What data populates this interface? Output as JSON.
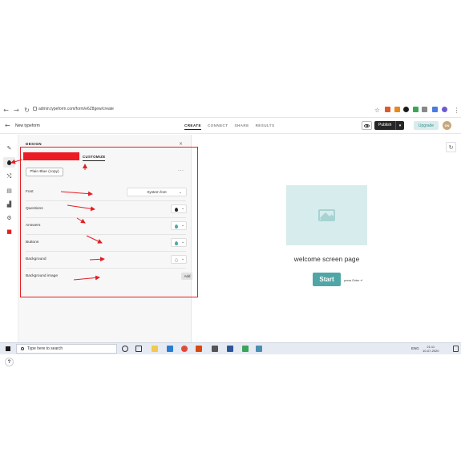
{
  "browser": {
    "url": "admin.typeform.com/form/e6Z8gew/create"
  },
  "header": {
    "form_name": "New typeform",
    "tabs": [
      "CREATE",
      "CONNECT",
      "SHARE",
      "RESULTS"
    ],
    "active_tab": "CREATE",
    "publish_label": "Publish",
    "upgrade_label": "Upgrade",
    "avatar_initials": "DN"
  },
  "design_panel": {
    "title": "DESIGN",
    "customize_tab": "CUSTOMIZE",
    "theme_name": "Plain Blue (copy)",
    "rows": [
      {
        "label": "Font",
        "value": "System font"
      },
      {
        "label": "Questions",
        "color": "#262627"
      },
      {
        "label": "Answers",
        "color": "#4fa6a6"
      },
      {
        "label": "Buttons",
        "color": "#4fa6a6"
      },
      {
        "label": "Background",
        "color": "#ffffff"
      },
      {
        "label": "Background image",
        "action": "Add"
      }
    ],
    "accent_color": "#e51d24"
  },
  "preview": {
    "welcome_text": "welcome screen page",
    "start_label": "Start",
    "press_enter": "press Enter ↵",
    "button_color": "#4fa6a6"
  },
  "taskbar": {
    "search_placeholder": "Type here to search",
    "lang": "ENG",
    "time": "21:11",
    "date": "10-07-2020"
  }
}
